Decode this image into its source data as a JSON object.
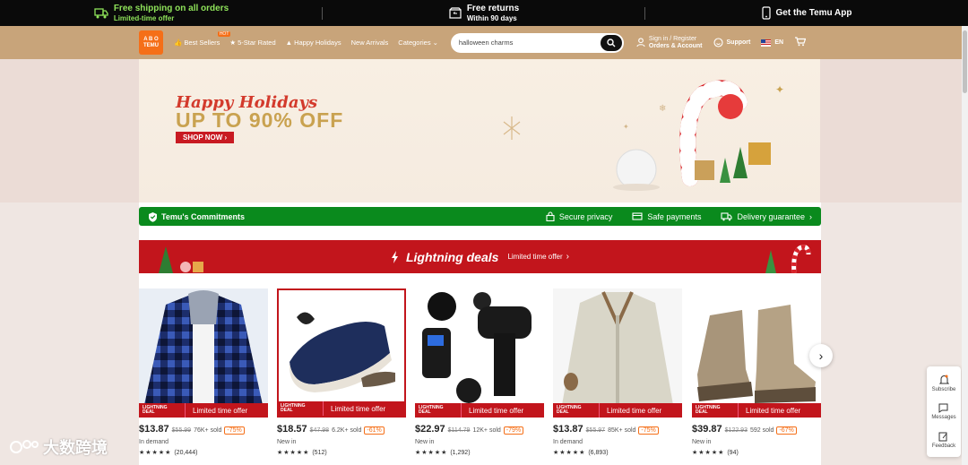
{
  "topbar": {
    "shipping_l1": "Free shipping on all orders",
    "shipping_l2": "Limited-time offer",
    "returns_l1": "Free returns",
    "returns_l2": "Within 90 days",
    "app": "Get the Temu App"
  },
  "nav": {
    "logo_top": "A B O",
    "logo_bottom": "TEMU",
    "links": [
      "Best Sellers",
      "5-Star Rated",
      "Happy Holidays",
      "New Arrivals",
      "Categories"
    ],
    "hot": "HOT",
    "search_value": "halloween charms",
    "account_l1": "Sign in / Register",
    "account_l2": "Orders & Account",
    "support": "Support",
    "language": "EN"
  },
  "hero": {
    "headline": "Happy Holidays",
    "offer": "UP TO 90% OFF",
    "cta": "SHOP NOW"
  },
  "commitments": {
    "title": "Temu's Commitments",
    "items": [
      "Secure privacy",
      "Safe payments",
      "Delivery guarantee"
    ]
  },
  "lightning": {
    "title": "Lightning deals",
    "sub": "Limited time offer"
  },
  "badge": {
    "ld1": "LIGHTNING",
    "ld2": "DEAL",
    "label": "Limited time offer"
  },
  "products": [
    {
      "price": "$13.87",
      "old": "$55.99",
      "sold": "76K+ sold",
      "disc": "-75%",
      "tag": "In demand",
      "rating": "★★★★★",
      "count": "(20,444)"
    },
    {
      "price": "$18.57",
      "old": "$47.98",
      "sold": "6.2K+ sold",
      "disc": "-61%",
      "tag": "New in",
      "rating": "★★★★★",
      "count": "(512)"
    },
    {
      "price": "$22.97",
      "old": "$114.79",
      "sold": "12K+ sold",
      "disc": "-79%",
      "tag": "New in",
      "rating": "★★★★★",
      "count": "(1,292)"
    },
    {
      "price": "$13.87",
      "old": "$55.97",
      "sold": "85K+ sold",
      "disc": "-75%",
      "tag": "In demand",
      "rating": "★★★★★",
      "count": "(6,893)"
    },
    {
      "price": "$39.87",
      "old": "$122.93",
      "sold": "592 sold",
      "disc": "-67%",
      "tag": "New in",
      "rating": "★★★★★",
      "count": "(94)"
    }
  ],
  "side": [
    "Subscribe",
    "Messages",
    "Feedback"
  ],
  "watermark": "大数跨境",
  "colors": {
    "accent": "#f56f18",
    "nav": "#c8a47a",
    "green": "#0a8a1d",
    "red": "#c2151c"
  }
}
